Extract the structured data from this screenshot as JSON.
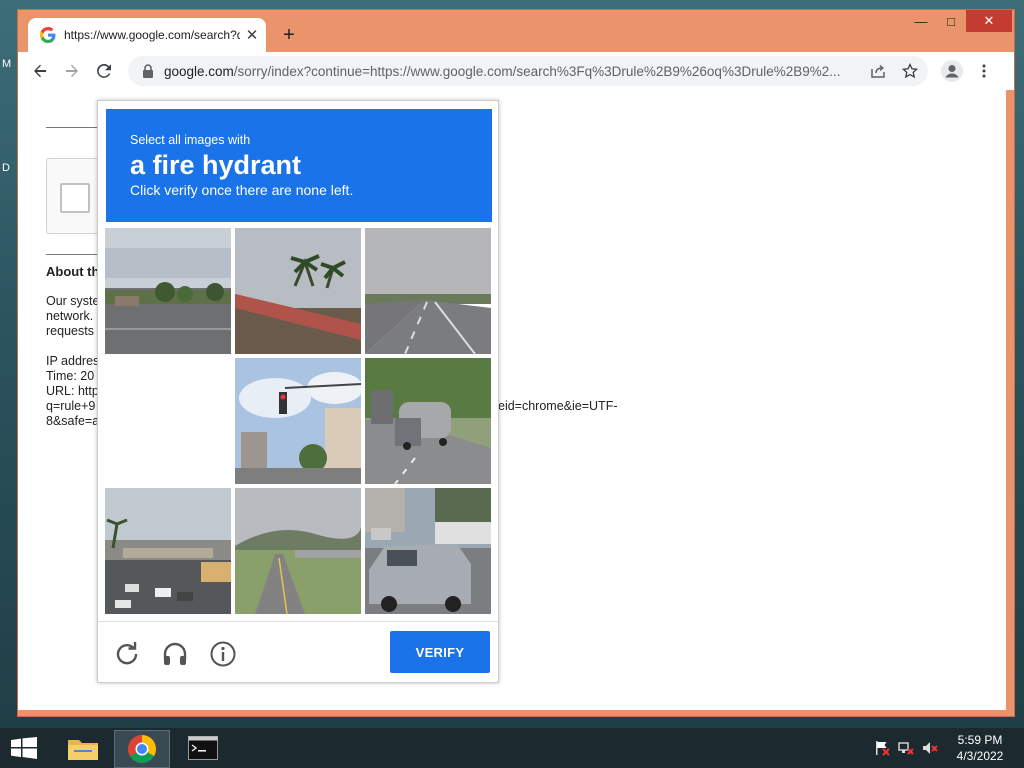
{
  "desktop": {
    "edge_letters": [
      "M",
      "D"
    ]
  },
  "window": {
    "controls": {
      "minimize": "—",
      "maximize": "□",
      "close": "✕"
    }
  },
  "tab": {
    "title": "https://www.google.com/search?q",
    "close": "✕"
  },
  "newtab": "+",
  "omnibox": {
    "host": "google.com",
    "rest": "/sorry/index?continue=https://www.google.com/search%3Fq%3Drule%2B9%26oq%3Drule%2B9%2..."
  },
  "page": {
    "about_heading": "About th",
    "para1": [
      "Our syste",
      "network.",
      "requests"
    ],
    "info": [
      "IP addres",
      "Time: 20",
      "URL: http",
      "q=rule+9",
      "8&safe=a"
    ],
    "url_tail": "eid=chrome&ie=UTF-"
  },
  "captcha": {
    "line1": "Select all images with",
    "target": "a fire hydrant",
    "line3": "Click verify once there are none left.",
    "verify_label": "VERIFY",
    "tiles": [
      "street-with-trees",
      "roof-with-palm-trees",
      "empty-highway",
      "blank-loading",
      "traffic-light-buildings",
      "tanker-truck-road",
      "overpass-traffic",
      "road-with-hills",
      "white-van"
    ]
  },
  "taskbar": {
    "apps": [
      "file-explorer",
      "chrome",
      "terminal"
    ],
    "time": "5:59 PM",
    "date": "4/3/2022"
  },
  "colors": {
    "accent": "#1a73e8",
    "window_frame": "#e9946a",
    "taskbar": "#1c2a30"
  }
}
